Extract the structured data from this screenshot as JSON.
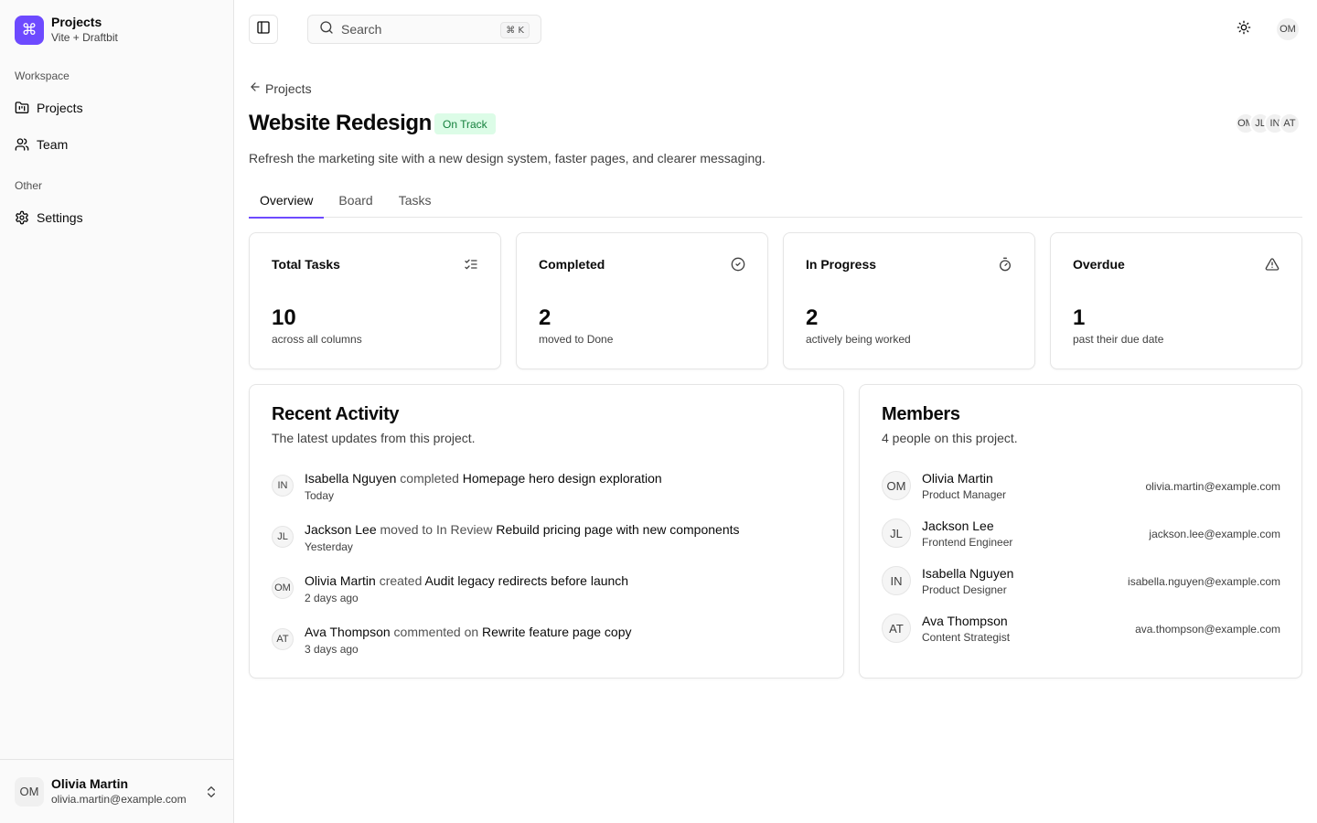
{
  "sidebar": {
    "brand_title": "Projects",
    "brand_subtitle": "Vite + Draftbit",
    "brand_icon": "⌘",
    "groups": [
      {
        "label": "Workspace",
        "items": [
          {
            "label": "Projects",
            "icon": "folder-kanban-icon"
          },
          {
            "label": "Team",
            "icon": "users-icon"
          }
        ]
      },
      {
        "label": "Other",
        "items": [
          {
            "label": "Settings",
            "icon": "gear-icon"
          }
        ]
      }
    ],
    "user": {
      "initials": "OM",
      "name": "Olivia Martin",
      "email": "olivia.martin@example.com"
    }
  },
  "header": {
    "search_placeholder": "Search",
    "shortcut": "⌘ K",
    "avatar_initials": "OM"
  },
  "page": {
    "breadcrumb": "Projects",
    "title": "Website Redesign",
    "status": "On Track",
    "status_color": "#15803d",
    "description": "Refresh the marketing site with a new design system, faster pages, and clearer messaging.",
    "member_stack": [
      "OM",
      "JL",
      "IN",
      "AT"
    ],
    "accent": "#6d4aff"
  },
  "tabs": [
    {
      "label": "Overview",
      "active": true
    },
    {
      "label": "Board",
      "active": false
    },
    {
      "label": "Tasks",
      "active": false
    }
  ],
  "stats": [
    {
      "title": "Total Tasks",
      "value": "10",
      "caption": "across all columns",
      "icon": "list-checks-icon"
    },
    {
      "title": "Completed",
      "value": "2",
      "caption": "moved to Done",
      "icon": "circle-check-icon"
    },
    {
      "title": "In Progress",
      "value": "2",
      "caption": "actively being worked",
      "icon": "timer-icon"
    },
    {
      "title": "Overdue",
      "value": "1",
      "caption": "past their due date",
      "icon": "warning-triangle-icon"
    }
  ],
  "activity": {
    "title": "Recent Activity",
    "subtitle": "The latest updates from this project.",
    "items": [
      {
        "initials": "IN",
        "who": "Isabella Nguyen",
        "verb": "completed",
        "what": "Homepage hero design exploration",
        "time": "Today"
      },
      {
        "initials": "JL",
        "who": "Jackson Lee",
        "verb": "moved to In Review",
        "what": "Rebuild pricing page with new components",
        "time": "Yesterday"
      },
      {
        "initials": "OM",
        "who": "Olivia Martin",
        "verb": "created",
        "what": "Audit legacy redirects before launch",
        "time": "2 days ago"
      },
      {
        "initials": "AT",
        "who": "Ava Thompson",
        "verb": "commented on",
        "what": "Rewrite feature page copy",
        "time": "3 days ago"
      }
    ]
  },
  "members": {
    "title": "Members",
    "subtitle": "4 people on this project.",
    "items": [
      {
        "initials": "OM",
        "name": "Olivia Martin",
        "role": "Product Manager",
        "email": "olivia.martin@example.com"
      },
      {
        "initials": "JL",
        "name": "Jackson Lee",
        "role": "Frontend Engineer",
        "email": "jackson.lee@example.com"
      },
      {
        "initials": "IN",
        "name": "Isabella Nguyen",
        "role": "Product Designer",
        "email": "isabella.nguyen@example.com"
      },
      {
        "initials": "AT",
        "name": "Ava Thompson",
        "role": "Content Strategist",
        "email": "ava.thompson@example.com"
      }
    ]
  }
}
